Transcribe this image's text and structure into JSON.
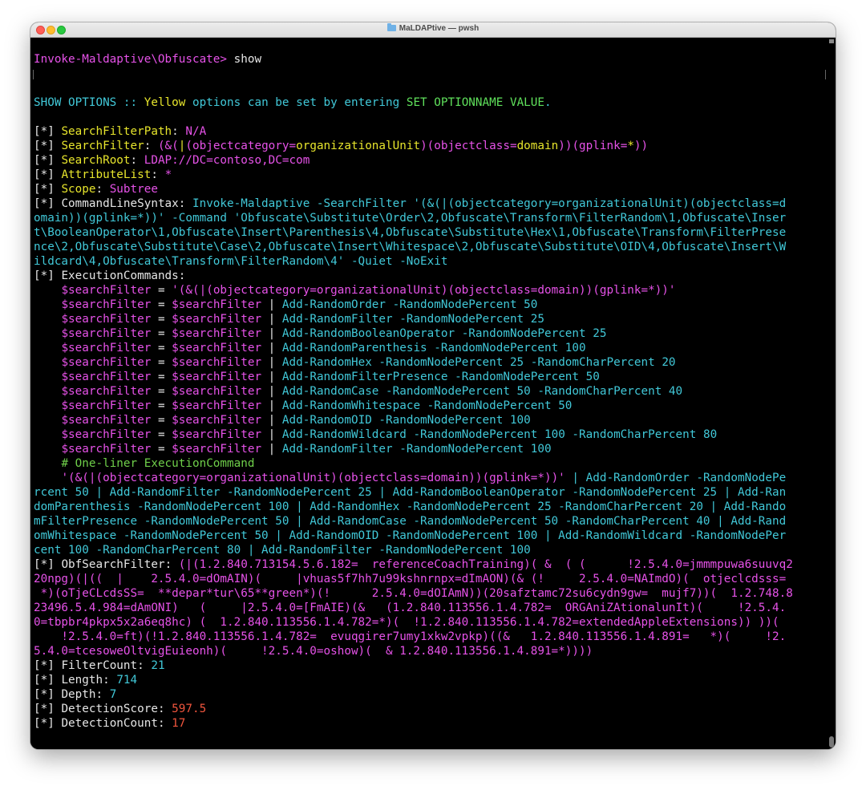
{
  "window": {
    "title": "MaLDAPtive — pwsh"
  },
  "prompt": {
    "path": "Invoke-Maldaptive\\Obfuscate>",
    "command": " show"
  },
  "header": {
    "p1": "SHOW OPTIONS :: ",
    "yellow": "Yellow",
    "p2": " options can be set by entering ",
    "set": "SET OPTIONNAME VALUE",
    "p3": "."
  },
  "options": {
    "searchfilterpath": {
      "key": "SearchFilterPath",
      "value": "N/A"
    },
    "searchfilter": {
      "key": "SearchFilter",
      "value": "(&(|(objectcategory=organizationalUnit)(objectclass=domain))(gplink=*))"
    },
    "searchroot": {
      "key": "SearchRoot",
      "value": "LDAP://DC=contoso,DC=com"
    },
    "attributelist": {
      "key": "AttributeList",
      "value": "*"
    },
    "scope": {
      "key": "Scope",
      "value": "Subtree"
    },
    "commandlinesyntax": {
      "key": "CommandLineSyntax",
      "lines": [
        "Invoke-Maldaptive -SearchFilter '(&(|(objectcategory=organizationalUnit)(objectclass=d",
        "omain))(gplink=*))' -Command 'Obfuscate\\Substitute\\Order\\2,Obfuscate\\Transform\\FilterRandom\\1,Obfuscate\\Inser",
        "t\\BooleanOperator\\1,Obfuscate\\Insert\\Parenthesis\\4,Obfuscate\\Substitute\\Hex\\1,Obfuscate\\Transform\\FilterPrese",
        "nce\\2,Obfuscate\\Substitute\\Case\\2,Obfuscate\\Insert\\Whitespace\\2,Obfuscate\\Substitute\\OID\\4,Obfuscate\\Insert\\W",
        "ildcard\\4,Obfuscate\\Transform\\FilterRandom\\4' -Quiet -NoExit"
      ]
    },
    "executioncommands": {
      "key": "ExecutionCommands",
      "first": {
        "var": "$searchFilter",
        "eq": " = ",
        "val": "'(&(|(objectcategory=organizationalUnit)(objectclass=domain))(gplink=*))'"
      },
      "pipe_rows": [
        {
          "a": "$searchFilter",
          "eq": " = ",
          "b": "$searchFilter",
          "pipe": " | ",
          "cmd": "Add-RandomOrder -RandomNodePercent 50"
        },
        {
          "a": "$searchFilter",
          "eq": " = ",
          "b": "$searchFilter",
          "pipe": " | ",
          "cmd": "Add-RandomFilter -RandomNodePercent 25"
        },
        {
          "a": "$searchFilter",
          "eq": " = ",
          "b": "$searchFilter",
          "pipe": " | ",
          "cmd": "Add-RandomBooleanOperator -RandomNodePercent 25"
        },
        {
          "a": "$searchFilter",
          "eq": " = ",
          "b": "$searchFilter",
          "pipe": " | ",
          "cmd": "Add-RandomParenthesis -RandomNodePercent 100"
        },
        {
          "a": "$searchFilter",
          "eq": " = ",
          "b": "$searchFilter",
          "pipe": " | ",
          "cmd": "Add-RandomHex -RandomNodePercent 25 -RandomCharPercent 20"
        },
        {
          "a": "$searchFilter",
          "eq": " = ",
          "b": "$searchFilter",
          "pipe": " | ",
          "cmd": "Add-RandomFilterPresence -RandomNodePercent 50"
        },
        {
          "a": "$searchFilter",
          "eq": " = ",
          "b": "$searchFilter",
          "pipe": " | ",
          "cmd": "Add-RandomCase -RandomNodePercent 50 -RandomCharPercent 40"
        },
        {
          "a": "$searchFilter",
          "eq": " = ",
          "b": "$searchFilter",
          "pipe": " | ",
          "cmd": "Add-RandomWhitespace -RandomNodePercent 50"
        },
        {
          "a": "$searchFilter",
          "eq": " = ",
          "b": "$searchFilter",
          "pipe": " | ",
          "cmd": "Add-RandomOID -RandomNodePercent 100"
        },
        {
          "a": "$searchFilter",
          "eq": " = ",
          "b": "$searchFilter",
          "pipe": " | ",
          "cmd": "Add-RandomWildcard -RandomNodePercent 100 -RandomCharPercent 80"
        },
        {
          "a": "$searchFilter",
          "eq": " = ",
          "b": "$searchFilter",
          "pipe": " | ",
          "cmd": "Add-RandomFilter -RandomNodePercent 100"
        }
      ],
      "comment": "# One-liner ExecutionCommand",
      "oneliner": {
        "filter": "'(&(|(objectcategory=organizationalUnit)(objectclass=domain))(gplink=*))'",
        "rest_first": " | Add-RandomOrder -RandomNodePe",
        "lines": [
          "rcent 50 | Add-RandomFilter -RandomNodePercent 25 | Add-RandomBooleanOperator -RandomNodePercent 25 | Add-Ran",
          "domParenthesis -RandomNodePercent 100 | Add-RandomHex -RandomNodePercent 25 -RandomCharPercent 20 | Add-Rando",
          "mFilterPresence -RandomNodePercent 50 | Add-RandomCase -RandomNodePercent 50 -RandomCharPercent 40 | Add-Rand",
          "omWhitespace -RandomNodePercent 50 | Add-RandomOID -RandomNodePercent 100 | Add-RandomWildcard -RandomNodePer",
          "cent 100 -RandomCharPercent 80 | Add-RandomFilter -RandomNodePercent 100"
        ]
      }
    },
    "obfsearchfilter": {
      "key": "ObfSearchFilter",
      "lines": [
        "(|(1.2.840.713154.5.6.182=  referenceCoachTraining)( &  ( (      !2.5.4.0=jmmmpuwa6suuvq2",
        "20npg)(|((  |    2.5.4.0=dOmAIN)(     |vhuas5f7hh7u99kshnrnpx=dImAON)(& (!     2.5.4.0=NAImdO)(  otjeclcdsss=",
        " *)(oTjeCLcdsSS=  **depar*tur\\65**green*)(!      2.5.4.0=dOIAmN))(20safztamc72su6cydn9gw=  mujf7))(  1.2.748.8",
        "23496.5.4.984=dAmONI)   (     |2.5.4.0=[FmAIE)(&   (1.2.840.113556.1.4.782=  ORGAniZAtionalunIt)(     !2.5.4.",
        "0=tbpbr4pkpx5x2a6eq8hc) (  1.2.840.113556.1.4.782=*)(  !1.2.840.113556.1.4.782=extendedAppleExtensions)) ))(",
        "    !2.5.4.0=ft)(!1.2.840.113556.1.4.782=  evuqgirer7umy1xkw2vpkp)((&   1.2.840.113556.1.4.891=   *)(     !2.",
        "5.4.0=tcesoweOltvigEuieonh)(     !2.5.4.0=oshow)(  & 1.2.840.113556.1.4.891=*))))"
      ]
    },
    "filtercount": {
      "key": "FilterCount",
      "value": "21"
    },
    "length": {
      "key": "Length",
      "value": "714"
    },
    "depth": {
      "key": "Depth",
      "value": "7"
    },
    "detectionscore": {
      "key": "DetectionScore",
      "value": "597.5"
    },
    "detectioncount": {
      "key": "DetectionCount",
      "value": "17"
    }
  },
  "bullet": "[*] ",
  "sep": ": ",
  "indent": "    ",
  "colors": {
    "background": "#000000",
    "magenta": "#e652e8",
    "yellow": "#e7e52c",
    "cyan": "#41c8d8",
    "green": "#5fe05b",
    "red": "#f0553d"
  }
}
